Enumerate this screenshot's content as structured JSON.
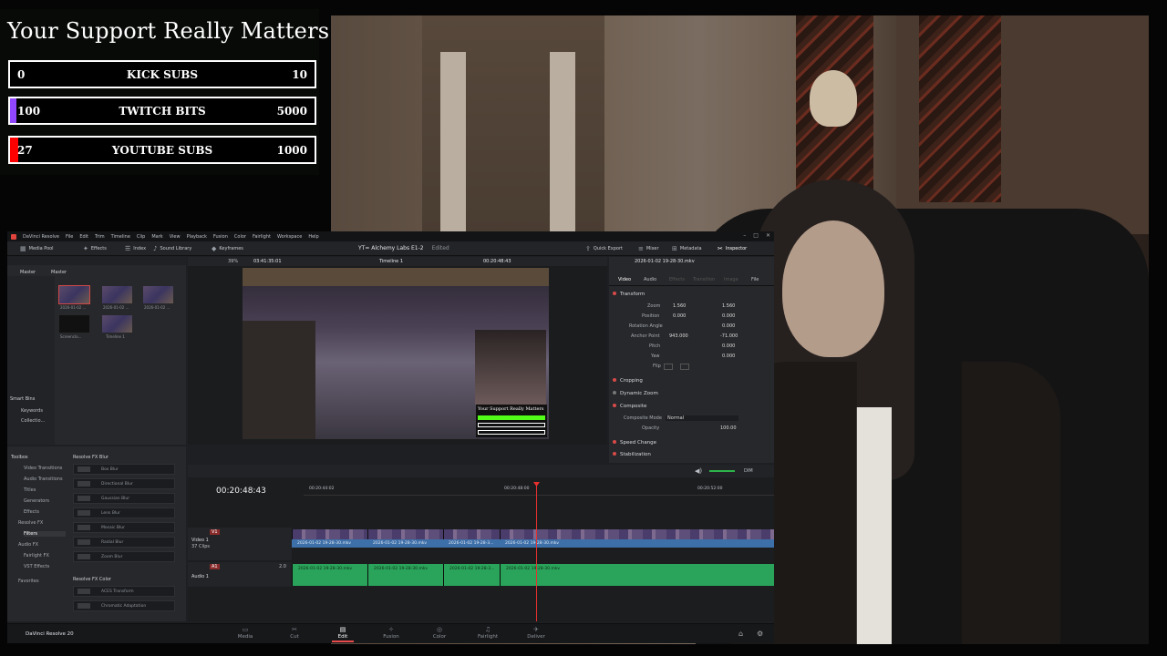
{
  "overlay": {
    "title": "Your Support Really Matters",
    "goals": [
      {
        "current": "0",
        "name": "KICK SUBS",
        "target": "10",
        "progress": 0.0,
        "color": "#53fc18"
      },
      {
        "current": "100",
        "name": "TWITCH BITS",
        "target": "5000",
        "progress": 0.02,
        "color": "#9146ff"
      },
      {
        "current": "27",
        "name": "YOUTUBE SUBS",
        "target": "1000",
        "progress": 0.027,
        "color": "#ff0000"
      }
    ]
  },
  "resolve": {
    "menu": [
      "DaVinci Resolve",
      "File",
      "Edit",
      "Trim",
      "Timeline",
      "Clip",
      "Mark",
      "View",
      "Playback",
      "Fusion",
      "Color",
      "Fairlight",
      "Workspace",
      "Help"
    ],
    "window_controls": [
      "–",
      "□",
      "✕"
    ],
    "toolbar": {
      "media_pool": "Media Pool",
      "effects": "Effects",
      "index": "Index",
      "sound_library": "Sound Library",
      "keyframes": "Keyframes",
      "project_title": "YT= Alchemy Labs E1-2",
      "edited": "Edited",
      "quick_export": "Quick Export",
      "mixer": "Mixer",
      "metadata": "Metadata",
      "inspector": "Inspector"
    },
    "media": {
      "bins": [
        "Master",
        "Master"
      ],
      "clips": [
        {
          "label": "2026-01-02 ..."
        },
        {
          "label": "2026-01-02 ..."
        },
        {
          "label": "2026-01-02 ..."
        },
        {
          "label": "Screenclo..."
        },
        {
          "label": "Timeline 1"
        }
      ],
      "smart_bins": "Smart Bins",
      "smart_items": [
        "Keywords",
        "Collectio..."
      ]
    },
    "viewer": {
      "zoom": "39%",
      "source_tc": "03:41:35:01",
      "timeline_name": "Timeline 1",
      "record_tc": "00:20:48:43",
      "overlay_title": "Your Support Really Matters"
    },
    "inspector": {
      "clip_name": "2026-01-02 19-28-30.mkv",
      "tabs": [
        "Video",
        "Audio",
        "Effects",
        "Transition",
        "Image",
        "File"
      ],
      "transform": "Transform",
      "rows": [
        {
          "label": "Zoom",
          "x": "1.560",
          "y": "1.560"
        },
        {
          "label": "Position",
          "x": "0.000",
          "y": "0.000"
        },
        {
          "label": "Rotation Angle",
          "v": "0.000"
        },
        {
          "label": "Anchor Point",
          "x": "943.000",
          "y": "-71.000"
        },
        {
          "label": "Pitch",
          "v": "0.000"
        },
        {
          "label": "Yaw",
          "v": "0.000"
        },
        {
          "label": "Flip",
          "v": ""
        }
      ],
      "sections": [
        "Cropping",
        "Dynamic Zoom",
        "Composite"
      ],
      "composite_mode_label": "Composite Mode",
      "composite_mode": "Normal",
      "opacity_label": "Opacity",
      "opacity": "100.00",
      "more": [
        "Speed Change",
        "Stabilization"
      ]
    },
    "effects": {
      "tree": [
        "Toolbox",
        "Video Transitions",
        "Audio Transitions",
        "Titles",
        "Generators",
        "Effects",
        "Resolve FX",
        "Filters",
        "Audio FX",
        "Fairlight FX",
        "VST Effects",
        "Favorites"
      ],
      "group1": "Resolve FX Blur",
      "blur": [
        "Box Blur",
        "Directional Blur",
        "Gaussian Blur",
        "Lens Blur",
        "Mosaic Blur",
        "Radial Blur",
        "Zoom Blur"
      ],
      "group2": "Resolve FX Color",
      "color": [
        "ACES Transform",
        "Chromatic Adaptation"
      ]
    },
    "timeline": {
      "timecode": "00:20:48:43",
      "ruler": [
        "00:20:44:02",
        "00:20:48:00",
        "00:20:52:00"
      ],
      "v1": "V1",
      "v1_name": "Video 1",
      "v1_count": "37 Clips",
      "a1": "A1",
      "a1_name": "Audio 1",
      "a1_level": "2.0",
      "clip_labels": [
        "2026-01-02 19-28-30.mkv",
        "2026-01-02 19-28-30.mkv",
        "2026-01-02 19-28-3...",
        "2026-01-02 19-28-30.mkv"
      ],
      "audio_level_label": "DIM"
    },
    "pages": [
      "Media",
      "Cut",
      "Edit",
      "Fusion",
      "Color",
      "Fairlight",
      "Deliver"
    ],
    "active_page": "Edit",
    "brand": "DaVinci Resolve 20"
  }
}
